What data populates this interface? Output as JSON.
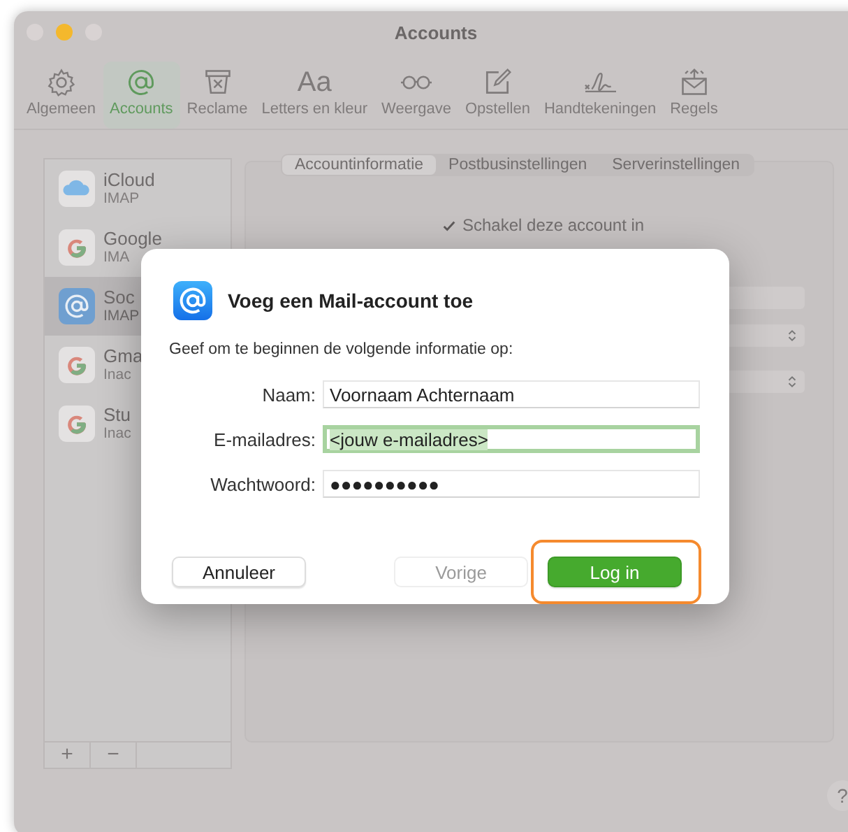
{
  "window": {
    "title": "Accounts"
  },
  "toolbar": [
    {
      "kind": "gear",
      "label": "Algemeen",
      "selected": false
    },
    {
      "kind": "at",
      "label": "Accounts",
      "selected": true
    },
    {
      "kind": "junk",
      "label": "Reclame",
      "selected": false
    },
    {
      "kind": "fonts",
      "glyph": "Aa",
      "label": "Letters en kleur",
      "selected": false
    },
    {
      "kind": "glasses",
      "label": "Weergave",
      "selected": false
    },
    {
      "kind": "compose",
      "label": "Opstellen",
      "selected": false
    },
    {
      "kind": "signature",
      "label": "Handtekeningen",
      "selected": false
    },
    {
      "kind": "rules",
      "label": "Regels",
      "selected": false
    }
  ],
  "accounts": [
    {
      "kind": "icloud",
      "name": "iCloud",
      "subtitle": "IMAP",
      "selected": false
    },
    {
      "kind": "google",
      "name": "Google",
      "subtitle": "IMA",
      "selected": false
    },
    {
      "kind": "at",
      "name": "Soc",
      "subtitle": "IMAP",
      "selected": true
    },
    {
      "kind": "google",
      "name": "Gma",
      "subtitle": "Inac",
      "selected": false
    },
    {
      "kind": "google",
      "name": "Stu",
      "subtitle": "Inac",
      "selected": false
    }
  ],
  "list_buttons": [
    "+",
    "−"
  ],
  "tabs": [
    {
      "label": "Accountinformatie",
      "selected": true
    },
    {
      "label": "Postbusinstellingen",
      "selected": false
    },
    {
      "label": "Serverinstellingen",
      "selected": false
    }
  ],
  "enable_checkbox": {
    "label": "Schakel deze account in",
    "checked": true
  },
  "dialog": {
    "title": "Voeg een Mail-account toe",
    "prompt": "Geef om te beginnen de volgende informatie op:",
    "fields": [
      {
        "label": "Naam:",
        "value": "Voornaam Achternaam",
        "focused": false,
        "selected_text": false
      },
      {
        "label": "E-mailadres:",
        "value": "<jouw e-mailadres>",
        "focused": true,
        "selected_text": true
      },
      {
        "label": "Wachtwoord:",
        "value": "●●●●●●●●●●",
        "focused": false,
        "selected_text": false
      }
    ],
    "buttons": [
      {
        "kind": "cancel",
        "label": "Annuleer",
        "disabled": false,
        "highlighted": false
      },
      {
        "kind": "back",
        "label": "Vorige",
        "disabled": true,
        "highlighted": false
      },
      {
        "kind": "default",
        "label": "Log in",
        "disabled": false,
        "highlighted": true
      }
    ]
  },
  "help_button": "?"
}
